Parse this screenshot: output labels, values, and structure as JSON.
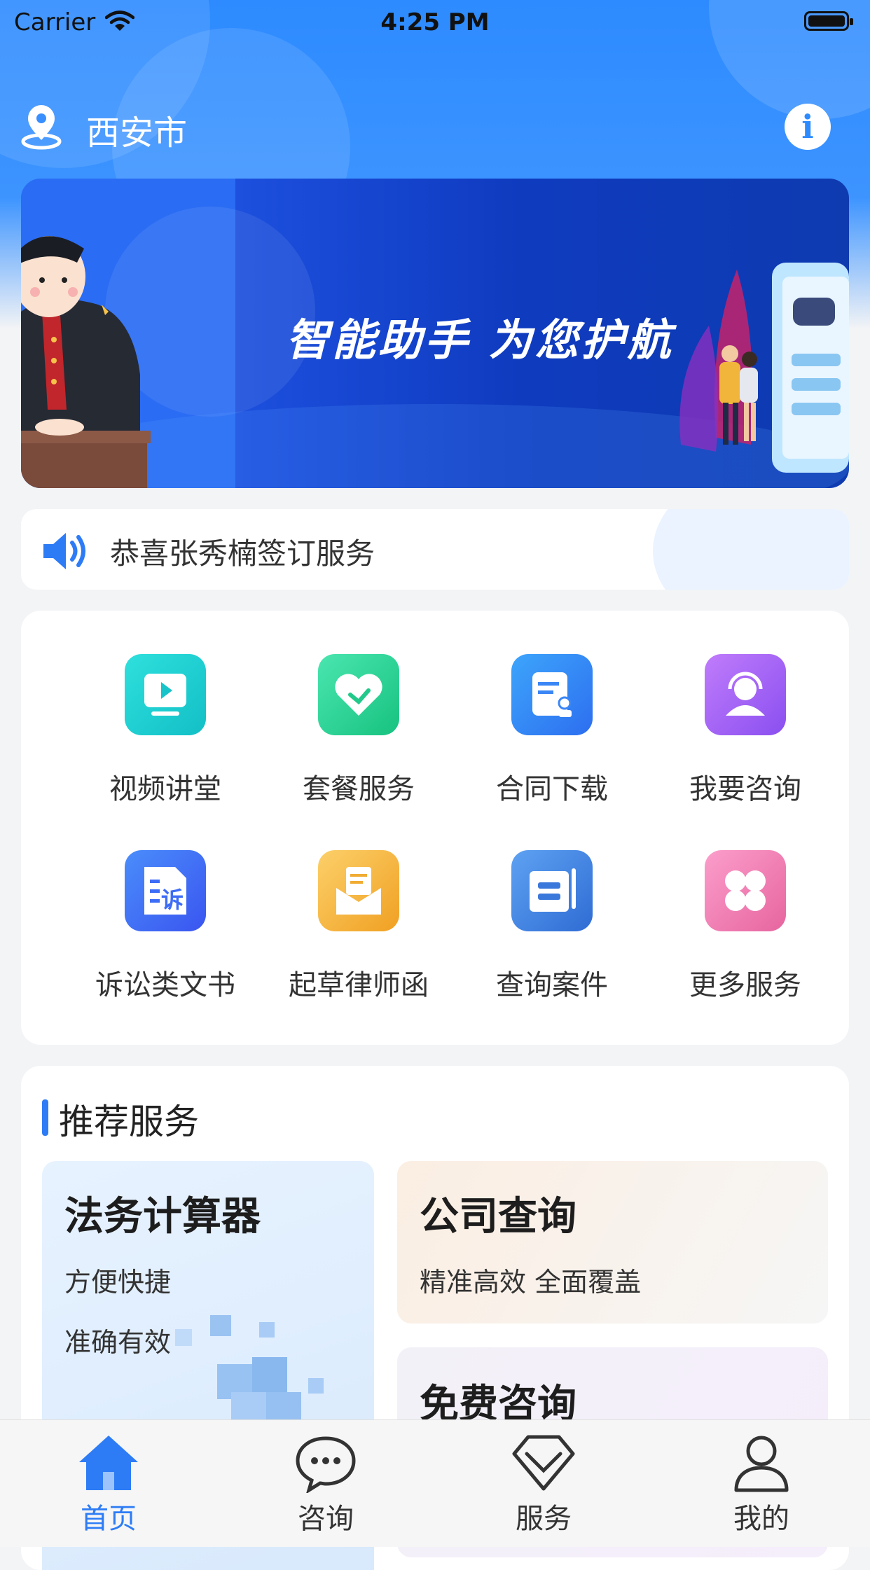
{
  "status_bar": {
    "carrier": "Carrier",
    "time": "4:25 PM"
  },
  "header": {
    "city": "西安市",
    "info_icon": "i"
  },
  "banner": {
    "slogan": "智能助手 为您护航"
  },
  "notice": {
    "text": "恭喜张秀楠签订服务"
  },
  "services": [
    {
      "label": "视频讲堂",
      "icon": "video-play-icon",
      "color": "#1fd0cf"
    },
    {
      "label": "套餐服务",
      "icon": "heart-icon",
      "color": "#2fd89a"
    },
    {
      "label": "合同下载",
      "icon": "contract-icon",
      "color": "#2e86f6"
    },
    {
      "label": "我要咨询",
      "icon": "headset-user-icon",
      "color": "#a05cf5"
    },
    {
      "label": "诉讼类文书",
      "icon": "lawsuit-doc-icon",
      "color": "#3d6cf6",
      "glyph": "诉"
    },
    {
      "label": "起草律师函",
      "icon": "letter-icon",
      "color": "#f6b23b"
    },
    {
      "label": "查询案件",
      "icon": "case-query-icon",
      "color": "#3f7fe0"
    },
    {
      "label": "更多服务",
      "icon": "more-grid-icon",
      "color": "#f07fb4"
    }
  ],
  "recommend": {
    "title": "推荐服务",
    "tiles": [
      {
        "title": "法务计算器",
        "subs": [
          "方便快捷",
          "准确有效"
        ]
      },
      {
        "title": "公司查询",
        "subs": [
          "精准高效 全面覆盖"
        ]
      },
      {
        "title": "免费咨询",
        "subs": []
      }
    ]
  },
  "tabs": [
    {
      "label": "首页",
      "icon": "home-icon",
      "active": true
    },
    {
      "label": "咨询",
      "icon": "chat-icon",
      "active": false
    },
    {
      "label": "服务",
      "icon": "service-icon",
      "active": false
    },
    {
      "label": "我的",
      "icon": "user-icon",
      "active": false
    }
  ],
  "colors": {
    "primary": "#2d7cf6",
    "header": "#2d8bff"
  }
}
